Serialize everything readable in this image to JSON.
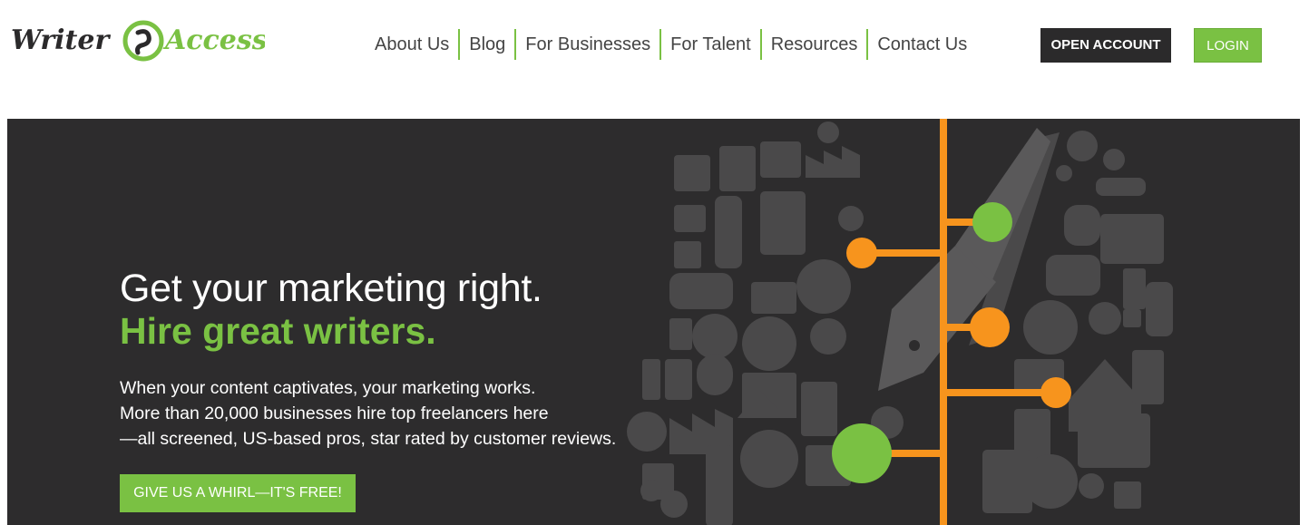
{
  "logo": {
    "word1": "Writer",
    "word2": "Access",
    "icon": "writeraccess-s-logo-icon"
  },
  "nav": {
    "items": [
      {
        "label": "About Us"
      },
      {
        "label": "Blog"
      },
      {
        "label": "For Businesses"
      },
      {
        "label": "For Talent"
      },
      {
        "label": "Resources"
      },
      {
        "label": "Contact Us"
      }
    ]
  },
  "header": {
    "open_account_label": "OPEN ACCOUNT",
    "login_label": "LOGIN"
  },
  "hero": {
    "title": "Get your marketing right.",
    "subtitle": "Hire great writers.",
    "body_lines": [
      "When your content captivates, your marketing works.",
      "More than 20,000 businesses hire top freelancers here",
      "—all screened, US-based pros, star rated by customer reviews."
    ],
    "cta_label": "GIVE US A WHIRL—IT'S FREE!",
    "illustration": "pen-and-marketing-icons-illustration"
  },
  "colors": {
    "brand_green": "#7ac143",
    "dark": "#2b2a2b",
    "orange": "#f7941d"
  }
}
